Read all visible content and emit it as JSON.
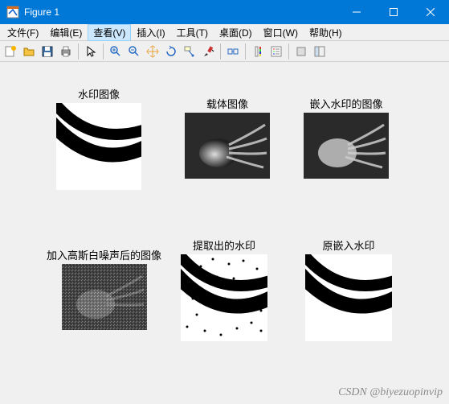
{
  "window": {
    "title": "Figure 1"
  },
  "menu": {
    "file": "文件(F)",
    "edit": "编辑(E)",
    "view": "查看(V)",
    "insert": "插入(I)",
    "tools": "工具(T)",
    "desktop": "桌面(D)",
    "window": "窗口(W)",
    "help": "帮助(H)"
  },
  "subplots": {
    "watermark_image": "水印图像",
    "carrier_image": "载体图像",
    "embedded_image": "嵌入水印的图像",
    "noisy_image": "加入高斯白噪声后的图像",
    "extracted_watermark": "提取出的水印",
    "original_embedded_watermark": "原嵌入水印"
  },
  "footer": {
    "csdn": "CSDN @biyezuopinvip"
  }
}
